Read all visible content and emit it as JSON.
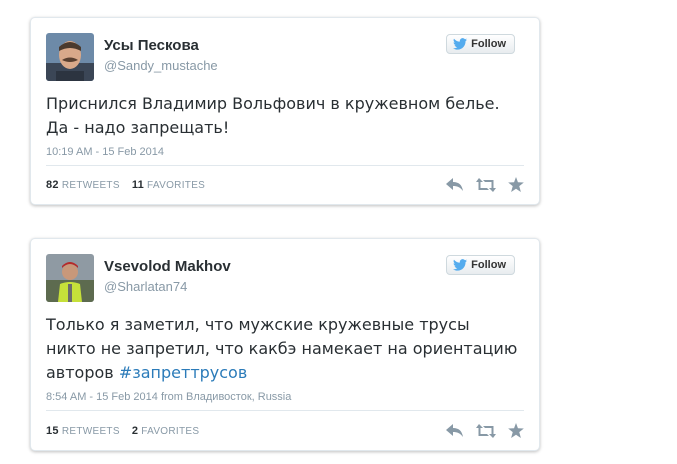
{
  "tweets": [
    {
      "author_name": "Усы Пескова",
      "handle": "@Sandy_mustache",
      "follow_label": "Follow",
      "text_lines": [
        "Приснился Владимир Вольфович в кружевном белье.",
        "Да - надо запрещать!"
      ],
      "timestamp": "10:19 AM - 15 Feb 2014",
      "retweets_count": "82",
      "retweets_label": "RETWEETS",
      "favorites_count": "11",
      "favorites_label": "FAVORITES",
      "avatar_icon": "man-with-mustache-photo"
    },
    {
      "author_name": "Vsevolod Makhov",
      "handle": "@Sharlatan74",
      "follow_label": "Follow",
      "text_lines": [
        "Только я заметил, что мужские кружевные трусы",
        "никто не запретил, что какбэ намекает на ориентацию",
        "авторов "
      ],
      "hashtag": "#запреттрусов",
      "timestamp": "8:54 AM - 15 Feb 2014 from Владивосток, Russia",
      "retweets_count": "15",
      "retweets_label": "RETWEETS",
      "favorites_count": "2",
      "favorites_label": "FAVORITES",
      "avatar_icon": "man-in-safety-vest-photo"
    }
  ],
  "colors": {
    "text": "#292f33",
    "muted": "#8899a6",
    "hashtag": "#2b7bb9",
    "twitter_bird": "#55acee",
    "action_icons": "#8899a6"
  },
  "icons": [
    "twitter-bird-icon",
    "reply-icon",
    "retweet-icon",
    "favorite-star-icon"
  ]
}
